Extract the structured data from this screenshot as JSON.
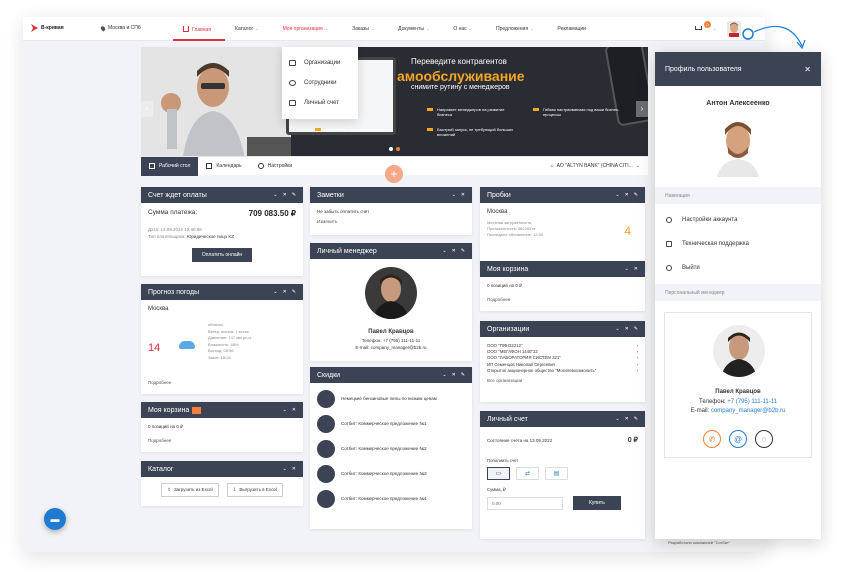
{
  "header": {
    "logo": "B-кривая",
    "city": "Москва и СПб",
    "nav": [
      {
        "label": "Главная",
        "active": true
      },
      {
        "label": "Каталог"
      },
      {
        "label": "Моя организация",
        "active_color": true
      },
      {
        "label": "Заказы"
      },
      {
        "label": "Документы"
      },
      {
        "label": "О нас"
      },
      {
        "label": "Предложения"
      },
      {
        "label": "Рекламации"
      }
    ],
    "cart_count": "0"
  },
  "org_menu": {
    "items": [
      "Организации",
      "Сотрудники",
      "Личный счет"
    ]
  },
  "hero": {
    "line1": "Переведите контрагентов",
    "line2": "амообслуживание",
    "line3": "снимите рутину с менеджеров",
    "features": [
      "Направьте менеджеров на развитие бизнеса",
      "Гибкая настраиваемая под ваши бизнес-процессы",
      "Выделитесь среди конкурентов",
      "Быстрый запуск, не требующий больших вложений"
    ]
  },
  "tabs": {
    "items": [
      "Рабочий стол",
      "Календарь",
      "Настройки"
    ],
    "org_selector": "АО \"ALTYN BANK\" (CHINA CITI..."
  },
  "invoice": {
    "title": "Счет ждет оплаты",
    "label": "Сумма платежа:",
    "amount": "709 083.50 ₽",
    "date": "Дата: 13.09.2022 12:40:56",
    "payer_label": "Тип плательщика:",
    "payer": "Юридическое лицо KZ",
    "button": "Оплатить онлайн"
  },
  "weather": {
    "title": "Прогноз погоды",
    "city": "Москва",
    "temp": "14",
    "details": [
      "облачно",
      "Ветер: восток, 1 м/сек.",
      "Давление: 747 мм.рт.ст.",
      "Влажность: 48%",
      "Восход: 05:56",
      "Закат: 18:04"
    ],
    "more": "Подробнее"
  },
  "cart_small": {
    "title": "Моя корзина",
    "text": "0 позиций на 0 ₽",
    "more": "Подробнее"
  },
  "catalog": {
    "title": "Каталог",
    "btn_load": "Загрузить из Excel",
    "btn_save": "Выгрузить в Excel"
  },
  "notes": {
    "title": "Заметки",
    "text": "Не забыть оплатить счёт",
    "edit": "Изменить"
  },
  "manager": {
    "title": "Личный менеджер",
    "name": "Павел Кравцов",
    "phone_label": "Телефон:",
    "phone": "+7 (795) 111-11-11",
    "email_label": "E-mail:",
    "email": "company_manager@b2b.ru"
  },
  "discounts": {
    "title": "Скидки",
    "items": [
      "Немецкие бензиновые пилы по низким ценам",
      "Сотбит: Коммерческое предложение №1",
      "Сотбит: Коммерческое предложение №2",
      "Сотбит: Коммерческое предложение №3",
      "Сотбит: Коммерческое предложение №4"
    ]
  },
  "traffic": {
    "title": "Пробки",
    "city": "Москва",
    "lines": [
      "Местная загруженность",
      "Протяженность: 482253 м",
      "Последнее обновление: 12:50"
    ],
    "level": "4"
  },
  "cart_mid": {
    "title": "Моя корзина",
    "text": "0 позиций на 0 ₽",
    "more": "Подробнее"
  },
  "orgs": {
    "title": "Организации",
    "items": [
      "ООО \"ПЯН32212\"",
      "ООО \"МЕГАФОН 1440\"22",
      "ООО \"ЛАБОРАТОРИЯ СИСТЕМ 321\"",
      "ИП Семенцов Николай Сергеевич",
      "Открытое акционерное общество \"Могилевхозмолить\""
    ],
    "all": "Все организации"
  },
  "account": {
    "title": "Личный счет",
    "state_label": "Состояние счета на 13.09.2022",
    "state_value": "0 ₽",
    "topup": "Пополнить счет",
    "sum_label": "Сумма, ₽",
    "sum_placeholder": "0.00",
    "buy": "Купить"
  },
  "profile": {
    "title": "Профиль пользователя",
    "name": "Антон Алексеенко",
    "nav_label": "Навигация",
    "nav_items": [
      "Настройки аккаунта",
      "Техническая поддержка",
      "Выйти"
    ],
    "manager_label": "Персональный менеджер",
    "manager_name": "Павел Кравцов",
    "phone_label": "Телефон:",
    "phone": "+7 (795) 111-11-11",
    "email_label": "E-mail:",
    "email": "company_manager@b2b.ru"
  },
  "footer": "Разработано компанией \"Сотбит\"",
  "colors": {
    "accent": "#e0313a",
    "dark": "#3c4354",
    "orange": "#f0813c",
    "link": "#1f7ad2"
  }
}
